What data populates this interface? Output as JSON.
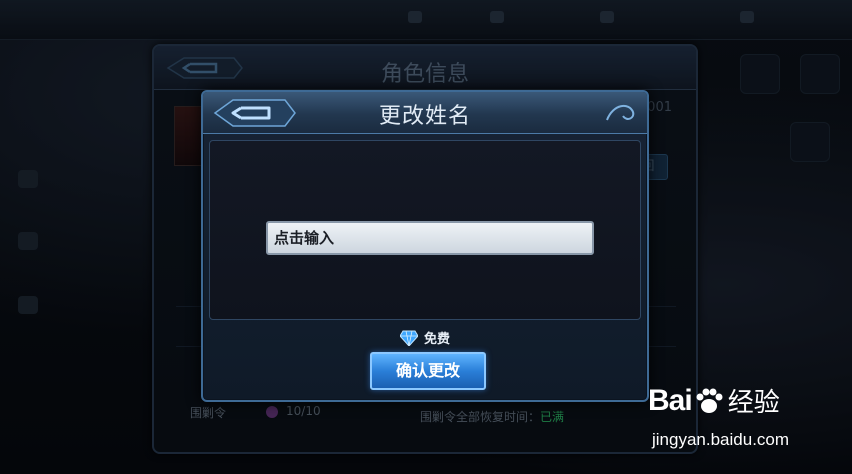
{
  "background": {
    "panel_title": "角色信息",
    "player_id_fragment": "001",
    "side_button_label": "回",
    "stat_label": "围剿令",
    "stat_value": "10/10",
    "stat_note": "围剿令全部恢复时间：",
    "stat_note_status": "已满"
  },
  "modal": {
    "title": "更改姓名",
    "input_placeholder": "点击输入",
    "cost_icon": "diamond-icon",
    "cost_label": "免费",
    "confirm_label": "确认更改"
  },
  "watermark": {
    "brand": "Bai",
    "brand_cn": "经验",
    "url": "jingyan.baidu.com"
  },
  "colors": {
    "accent_blue": "#2a7fd8",
    "modal_border": "#3e6a95",
    "status_green": "#2fbf6a"
  }
}
